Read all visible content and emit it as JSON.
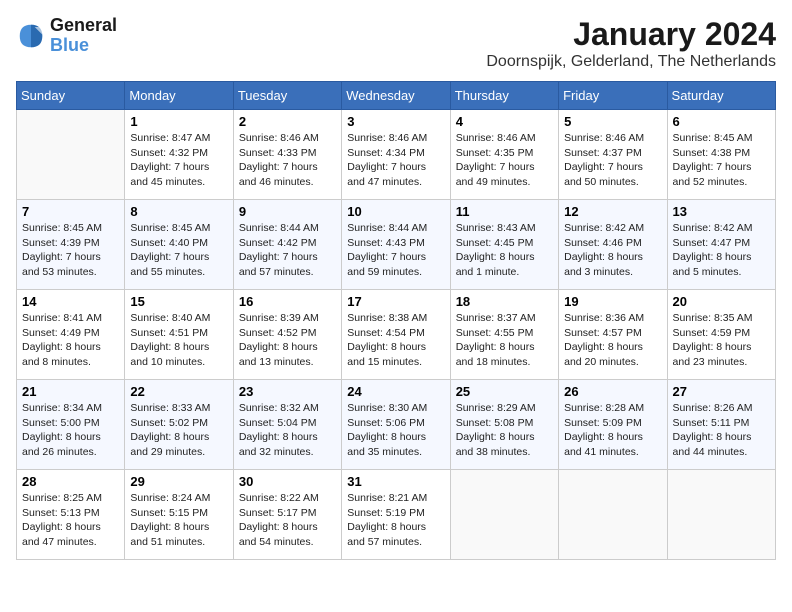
{
  "logo": {
    "line1": "General",
    "line2": "Blue"
  },
  "title": "January 2024",
  "subtitle": "Doornspijk, Gelderland, The Netherlands",
  "days_of_week": [
    "Sunday",
    "Monday",
    "Tuesday",
    "Wednesday",
    "Thursday",
    "Friday",
    "Saturday"
  ],
  "weeks": [
    [
      {
        "day": "",
        "info": ""
      },
      {
        "day": "1",
        "info": "Sunrise: 8:47 AM\nSunset: 4:32 PM\nDaylight: 7 hours\nand 45 minutes."
      },
      {
        "day": "2",
        "info": "Sunrise: 8:46 AM\nSunset: 4:33 PM\nDaylight: 7 hours\nand 46 minutes."
      },
      {
        "day": "3",
        "info": "Sunrise: 8:46 AM\nSunset: 4:34 PM\nDaylight: 7 hours\nand 47 minutes."
      },
      {
        "day": "4",
        "info": "Sunrise: 8:46 AM\nSunset: 4:35 PM\nDaylight: 7 hours\nand 49 minutes."
      },
      {
        "day": "5",
        "info": "Sunrise: 8:46 AM\nSunset: 4:37 PM\nDaylight: 7 hours\nand 50 minutes."
      },
      {
        "day": "6",
        "info": "Sunrise: 8:45 AM\nSunset: 4:38 PM\nDaylight: 7 hours\nand 52 minutes."
      }
    ],
    [
      {
        "day": "7",
        "info": "Sunrise: 8:45 AM\nSunset: 4:39 PM\nDaylight: 7 hours\nand 53 minutes."
      },
      {
        "day": "8",
        "info": "Sunrise: 8:45 AM\nSunset: 4:40 PM\nDaylight: 7 hours\nand 55 minutes."
      },
      {
        "day": "9",
        "info": "Sunrise: 8:44 AM\nSunset: 4:42 PM\nDaylight: 7 hours\nand 57 minutes."
      },
      {
        "day": "10",
        "info": "Sunrise: 8:44 AM\nSunset: 4:43 PM\nDaylight: 7 hours\nand 59 minutes."
      },
      {
        "day": "11",
        "info": "Sunrise: 8:43 AM\nSunset: 4:45 PM\nDaylight: 8 hours\nand 1 minute."
      },
      {
        "day": "12",
        "info": "Sunrise: 8:42 AM\nSunset: 4:46 PM\nDaylight: 8 hours\nand 3 minutes."
      },
      {
        "day": "13",
        "info": "Sunrise: 8:42 AM\nSunset: 4:47 PM\nDaylight: 8 hours\nand 5 minutes."
      }
    ],
    [
      {
        "day": "14",
        "info": "Sunrise: 8:41 AM\nSunset: 4:49 PM\nDaylight: 8 hours\nand 8 minutes."
      },
      {
        "day": "15",
        "info": "Sunrise: 8:40 AM\nSunset: 4:51 PM\nDaylight: 8 hours\nand 10 minutes."
      },
      {
        "day": "16",
        "info": "Sunrise: 8:39 AM\nSunset: 4:52 PM\nDaylight: 8 hours\nand 13 minutes."
      },
      {
        "day": "17",
        "info": "Sunrise: 8:38 AM\nSunset: 4:54 PM\nDaylight: 8 hours\nand 15 minutes."
      },
      {
        "day": "18",
        "info": "Sunrise: 8:37 AM\nSunset: 4:55 PM\nDaylight: 8 hours\nand 18 minutes."
      },
      {
        "day": "19",
        "info": "Sunrise: 8:36 AM\nSunset: 4:57 PM\nDaylight: 8 hours\nand 20 minutes."
      },
      {
        "day": "20",
        "info": "Sunrise: 8:35 AM\nSunset: 4:59 PM\nDaylight: 8 hours\nand 23 minutes."
      }
    ],
    [
      {
        "day": "21",
        "info": "Sunrise: 8:34 AM\nSunset: 5:00 PM\nDaylight: 8 hours\nand 26 minutes."
      },
      {
        "day": "22",
        "info": "Sunrise: 8:33 AM\nSunset: 5:02 PM\nDaylight: 8 hours\nand 29 minutes."
      },
      {
        "day": "23",
        "info": "Sunrise: 8:32 AM\nSunset: 5:04 PM\nDaylight: 8 hours\nand 32 minutes."
      },
      {
        "day": "24",
        "info": "Sunrise: 8:30 AM\nSunset: 5:06 PM\nDaylight: 8 hours\nand 35 minutes."
      },
      {
        "day": "25",
        "info": "Sunrise: 8:29 AM\nSunset: 5:08 PM\nDaylight: 8 hours\nand 38 minutes."
      },
      {
        "day": "26",
        "info": "Sunrise: 8:28 AM\nSunset: 5:09 PM\nDaylight: 8 hours\nand 41 minutes."
      },
      {
        "day": "27",
        "info": "Sunrise: 8:26 AM\nSunset: 5:11 PM\nDaylight: 8 hours\nand 44 minutes."
      }
    ],
    [
      {
        "day": "28",
        "info": "Sunrise: 8:25 AM\nSunset: 5:13 PM\nDaylight: 8 hours\nand 47 minutes."
      },
      {
        "day": "29",
        "info": "Sunrise: 8:24 AM\nSunset: 5:15 PM\nDaylight: 8 hours\nand 51 minutes."
      },
      {
        "day": "30",
        "info": "Sunrise: 8:22 AM\nSunset: 5:17 PM\nDaylight: 8 hours\nand 54 minutes."
      },
      {
        "day": "31",
        "info": "Sunrise: 8:21 AM\nSunset: 5:19 PM\nDaylight: 8 hours\nand 57 minutes."
      },
      {
        "day": "",
        "info": ""
      },
      {
        "day": "",
        "info": ""
      },
      {
        "day": "",
        "info": ""
      }
    ]
  ]
}
